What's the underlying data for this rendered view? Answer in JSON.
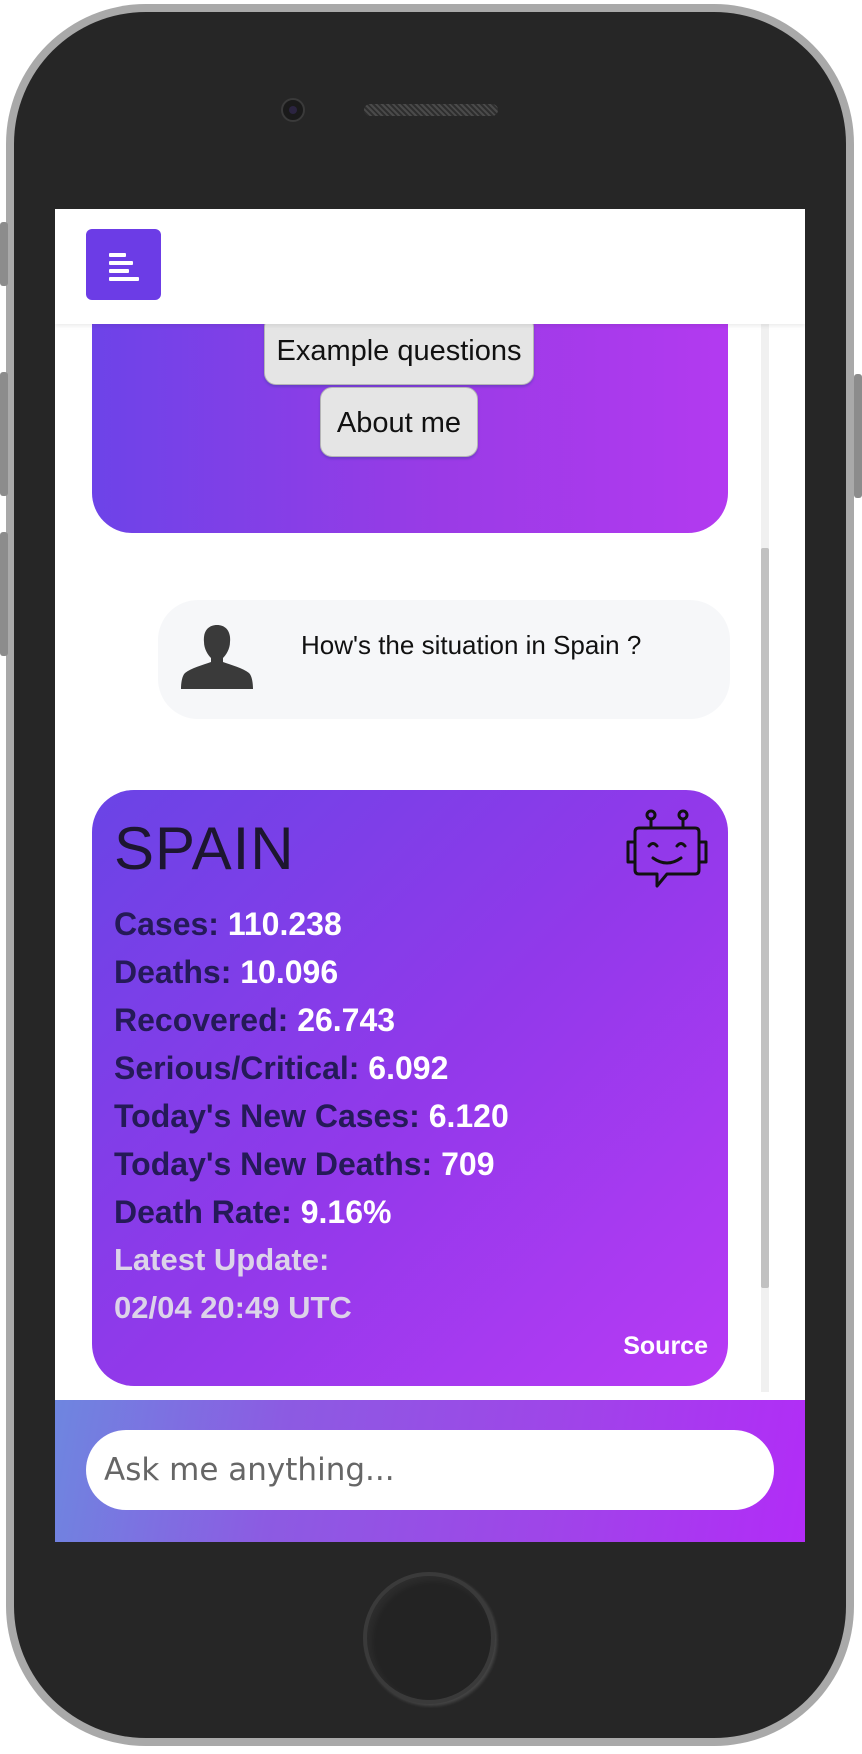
{
  "topbar": {
    "menu_icon": "menu-lines-icon"
  },
  "welcome": {
    "buttons": [
      {
        "label": "Example questions"
      },
      {
        "label": "About me"
      }
    ]
  },
  "user_message": {
    "avatar_icon": "user-silhouette-icon",
    "text": "How's the situation in Spain ?"
  },
  "bot_message": {
    "icon": "robot-chat-icon",
    "country": "SPAIN",
    "stats": [
      {
        "label": "Cases:",
        "value": "110.238"
      },
      {
        "label": "Deaths:",
        "value": "10.096"
      },
      {
        "label": "Recovered:",
        "value": "26.743"
      },
      {
        "label": "Serious/Critical:",
        "value": "6.092"
      },
      {
        "label": "Today's New Cases:",
        "value": "6.120"
      },
      {
        "label": "Today's New Deaths:",
        "value": "709"
      },
      {
        "label": "Death Rate:",
        "value": "9.16%"
      }
    ],
    "update_label": "Latest Update:",
    "update_value": "02/04 20:49 UTC",
    "source_label": "Source"
  },
  "input": {
    "placeholder": "Ask me anything..."
  },
  "colors": {
    "accent": "#6c3ce6",
    "card_gradient_start": "#6a44e6",
    "card_gradient_end": "#b83af5"
  }
}
